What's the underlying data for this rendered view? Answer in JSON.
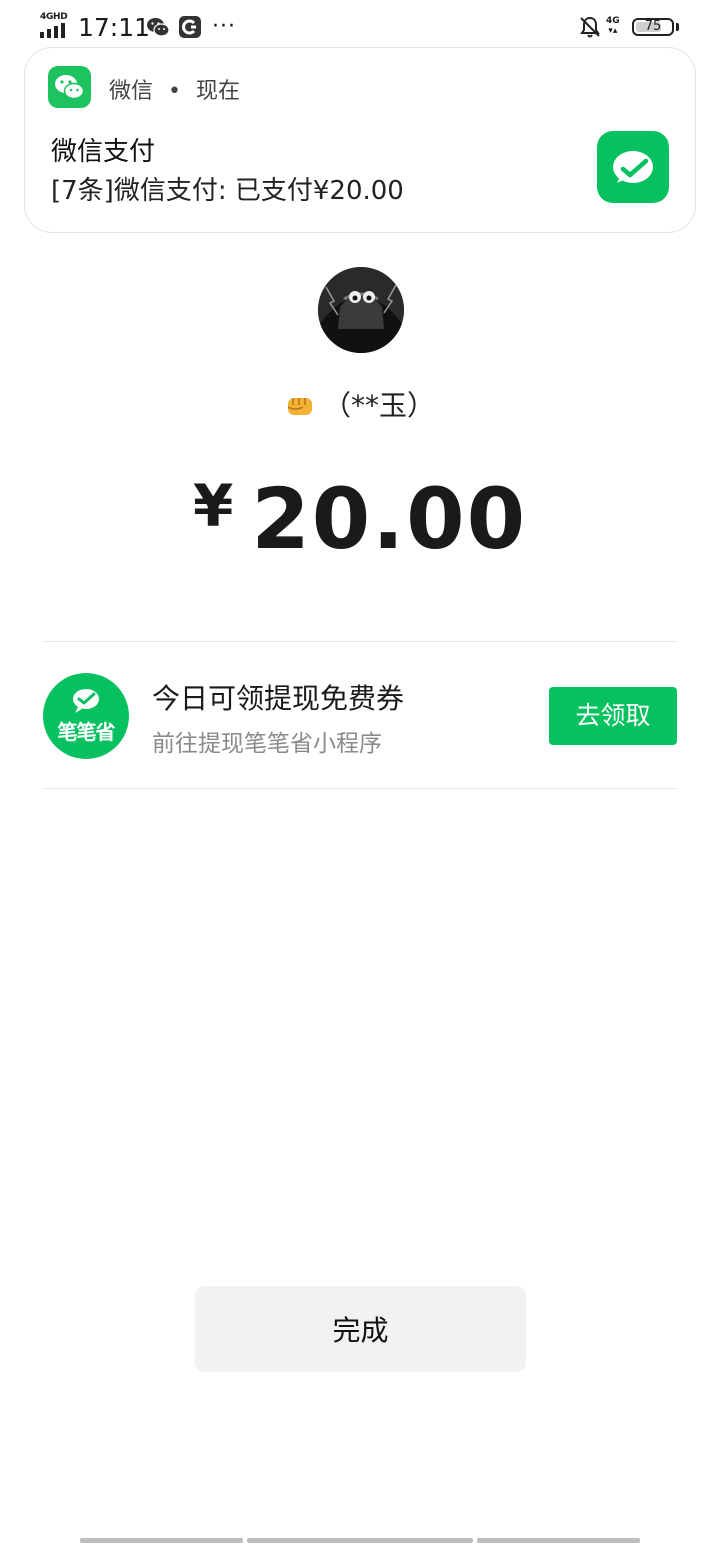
{
  "status_bar": {
    "network_label": "4GHD",
    "time": "17:11",
    "more": "···",
    "data_label": "4G",
    "battery": "75",
    "battery_level": 0.75
  },
  "notification": {
    "app_name": "微信",
    "separator": "•",
    "when": "现在",
    "title": "微信支付",
    "body": "[7条]微信支付: 已支付¥20.00",
    "brand_color": "#07c160"
  },
  "payment": {
    "payee": "（**玉）",
    "currency": "¥",
    "amount": "20.00"
  },
  "promo": {
    "logo_text": "笔笔省",
    "title": "今日可领提现免费券",
    "subtitle": "前往提现笔笔省小程序",
    "button_label": "去领取"
  },
  "done_label": "完成",
  "icons": {
    "signal": "signal-icon",
    "wechat_status": "wechat-status-icon",
    "app_status": "app-status-icon",
    "mute": "bell-mute-icon",
    "payee_emoji": "fist-emoji-icon",
    "wechat_pay": "wechat-pay-icon"
  }
}
